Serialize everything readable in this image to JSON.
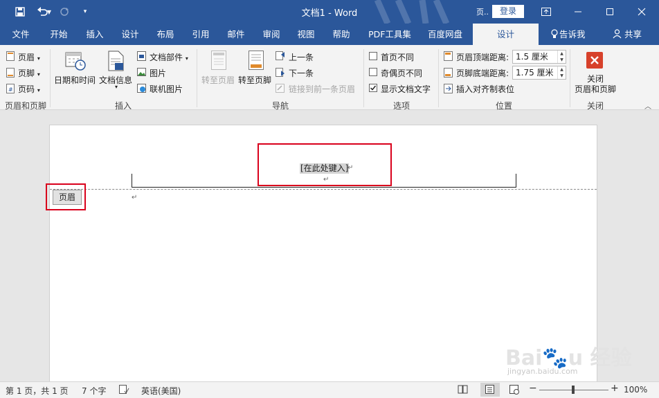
{
  "window": {
    "title": "文档1  -  Word",
    "account_text": "页..",
    "login_label": "登录"
  },
  "tabs": [
    "文件",
    "开始",
    "插入",
    "设计",
    "布局",
    "引用",
    "邮件",
    "审阅",
    "视图",
    "帮助",
    "PDF工具集",
    "百度网盘",
    "设计"
  ],
  "tell_me": "告诉我",
  "share": "共享",
  "ribbon": {
    "header_footer": {
      "header": "页眉",
      "footer": "页脚",
      "page_number": "页码",
      "group": "页眉和页脚"
    },
    "insert": {
      "date_time": "日期和时间",
      "doc_info": "文档信息",
      "doc_parts": "文档部件",
      "picture": "图片",
      "online_picture": "联机图片",
      "group": "插入"
    },
    "navigation": {
      "goto_header": "转至页眉",
      "goto_footer": "转至页脚",
      "prev": "上一条",
      "next": "下一条",
      "link_prev": "链接到前一条页眉",
      "group": "导航"
    },
    "options": {
      "first_page": "首页不同",
      "odd_even": "奇偶页不同",
      "show_text": "显示文档文字",
      "group": "选项"
    },
    "position": {
      "header_top": "页眉顶端距离:",
      "header_top_value": "1.5 厘米",
      "footer_bottom": "页脚底端距离:",
      "footer_bottom_value": "1.75 厘米",
      "insert_tab": "插入对齐制表位",
      "group": "位置"
    },
    "close": {
      "label_line1": "关闭",
      "label_line2": "页眉和页脚",
      "group": "关闭"
    }
  },
  "document": {
    "placeholder": "[在此处键入]",
    "para_mark": "↵",
    "header_tag": "页眉"
  },
  "status": {
    "page": "第 1 页，共 1 页",
    "words": "7 个字",
    "language": "英语(美国)",
    "zoom": "100%"
  },
  "colors": {
    "brand": "#2b579a",
    "highlight": "#d9001b"
  }
}
